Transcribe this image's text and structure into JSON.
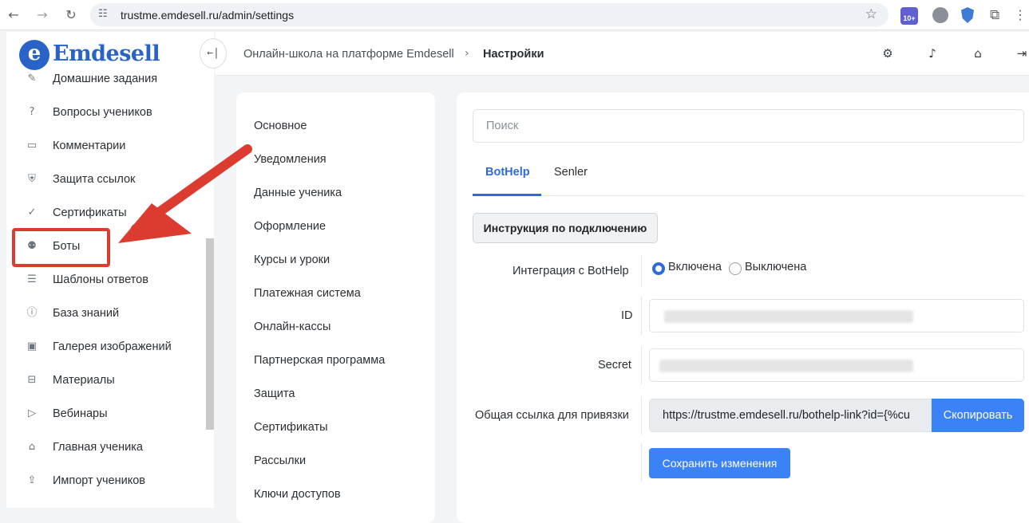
{
  "browser": {
    "url": "trustme.emdesell.ru/admin/settings",
    "icons": [
      "back-icon",
      "forward-icon",
      "reload-icon",
      "site-settings-icon",
      "bookmark-star-icon",
      "extensions-icon"
    ],
    "badge_text": "10+"
  },
  "brand": {
    "logo_letter": "e",
    "name": "Emdesell",
    "color": "#2a63c8"
  },
  "sidebar": {
    "items": [
      {
        "label": "Домашние задания",
        "icon": "pencil-icon"
      },
      {
        "label": "Вопросы учеников",
        "icon": "question-circle-icon"
      },
      {
        "label": "Комментарии",
        "icon": "comment-icon"
      },
      {
        "label": "Защита ссылок",
        "icon": "shield-icon"
      },
      {
        "label": "Сертификаты",
        "icon": "badge-check-icon"
      },
      {
        "label": "Боты",
        "icon": "robot-icon"
      },
      {
        "label": "Шаблоны ответов",
        "icon": "list-icon"
      },
      {
        "label": "База знаний",
        "icon": "info-icon"
      },
      {
        "label": "Галерея изображений",
        "icon": "image-icon"
      },
      {
        "label": "Материалы",
        "icon": "briefcase-icon"
      },
      {
        "label": "Вебинары",
        "icon": "play-icon"
      },
      {
        "label": "Главная ученика",
        "icon": "home-gear-icon"
      },
      {
        "label": "Импорт учеников",
        "icon": "upload-icon"
      }
    ],
    "highlighted": "Боты"
  },
  "header": {
    "breadcrumb_parent": "Онлайн-школа на платформе Emdesell",
    "breadcrumb_current": "Настройки",
    "icons": [
      "sliders-icon",
      "bell-icon",
      "home-settings-icon",
      "logout-icon"
    ]
  },
  "settings_nav": {
    "items": [
      "Основное",
      "Уведомления",
      "Данные ученика",
      "Оформление",
      "Курсы и уроки",
      "Платежная система",
      "Онлайн-кассы",
      "Партнерская программа",
      "Защита",
      "Сертификаты",
      "Рассылки",
      "Ключи доступов"
    ]
  },
  "main": {
    "search_placeholder": "Поиск",
    "tabs": [
      {
        "label": "BotHelp",
        "active": true
      },
      {
        "label": "Senler",
        "active": false
      }
    ],
    "instruction_button": "Инструкция по подключению",
    "integration_label": "Интеграция с BotHelp",
    "integration_options": [
      {
        "label": "Включена",
        "checked": true
      },
      {
        "label": "Выключена",
        "checked": false
      }
    ],
    "id_label": "ID",
    "secret_label": "Secret",
    "link_label": "Общая ссылка для привязки",
    "link_value": "https://trustme.emdesell.ru/bothelp-link?id={%cu",
    "copy_button": "Скопировать",
    "save_button": "Сохранить изменения",
    "accent_color": "#3b82f6"
  }
}
